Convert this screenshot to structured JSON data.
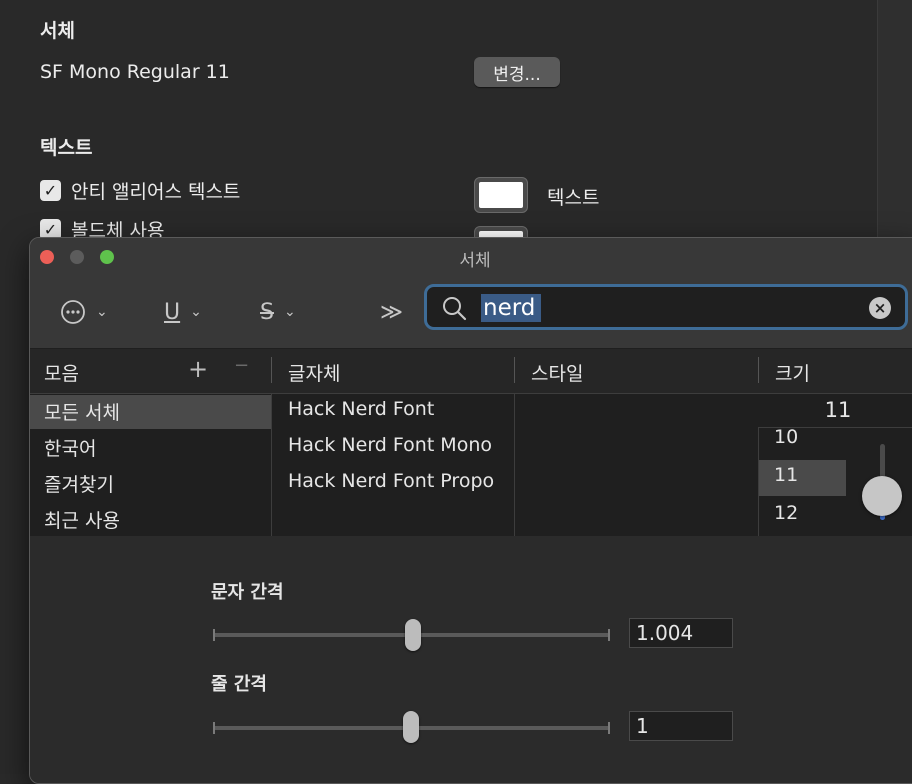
{
  "background": {
    "font_section_title": "서체",
    "font_value": "SF Mono Regular 11",
    "change_button": "변경...",
    "text_section_title": "텍스트",
    "antialias_label": "안티 앨리어스 텍스트",
    "bold_label": "볼드체 사용",
    "text_color_label": "텍스트"
  },
  "window": {
    "title": "서체",
    "traffic_lights": {
      "close": "#ec5f57",
      "minimize": "#5c5c5c",
      "zoom": "#5fc24c"
    }
  },
  "toolbar": {
    "more_icon": "ellipsis-circle-icon",
    "underline_glyph": "U",
    "strike_glyph": "S",
    "overflow_glyph": "≫"
  },
  "search": {
    "value": "nerd"
  },
  "columns": {
    "collections": "모음",
    "add": "+",
    "remove": "−",
    "family": "글자체",
    "style": "스타일",
    "size": "크기"
  },
  "collections": [
    "모든 서체",
    "한국어",
    "즐겨찾기",
    "최근 사용"
  ],
  "families": [
    "Hack Nerd Font",
    "Hack Nerd Font Mono",
    "Hack Nerd Font Propo"
  ],
  "size": {
    "current": "11",
    "options": [
      "10",
      "11",
      "12"
    ]
  },
  "spacing": {
    "char_label": "문자 간격",
    "char_value": "1.004",
    "line_label": "줄 간격",
    "line_value": "1"
  }
}
